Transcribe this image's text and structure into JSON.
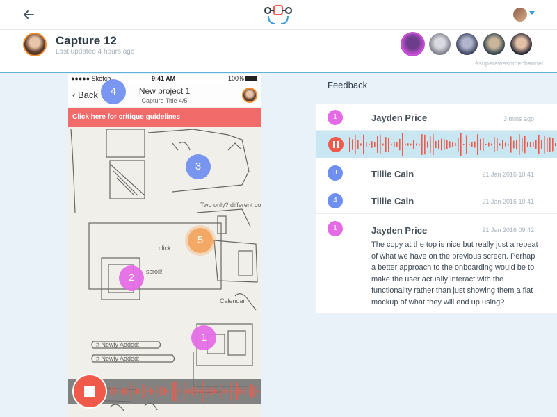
{
  "topbar": {
    "back_icon": "back-arrow-icon",
    "logo": "app-logo",
    "user_menu_icon": "chevron-down-icon"
  },
  "header": {
    "title": "Capture 12",
    "subtitle": "Last updated 4 hours ago",
    "channel": "#superawesomechannel"
  },
  "phone": {
    "status_left": "●●●●● Sketch",
    "status_time": "9:41 AM",
    "status_right": "100%",
    "back_label": "Back",
    "nav_title": "New project 1",
    "nav_subtitle": "Capture Title 4/5",
    "guidelines": "Click here for critique guidelines",
    "markers": [
      {
        "num": "4",
        "color": "blue"
      },
      {
        "num": "3",
        "color": "blue"
      },
      {
        "num": "5",
        "color": "orange"
      },
      {
        "num": "2",
        "color": "pink"
      },
      {
        "num": "1",
        "color": "pink"
      }
    ],
    "sketch_notes": [
      "Two only? different coloured",
      "click",
      "scroll!",
      "Calendar",
      "# Newly Added:",
      "# Newly Added:"
    ]
  },
  "feedback": {
    "label": "Feedback",
    "items": [
      {
        "num": "1",
        "name": "Jayden Price",
        "time": "3 mins ago",
        "color": "#e56ae6"
      },
      {
        "num": "3",
        "name": "Tillie Cain",
        "time": "21 Jan 2016 10:41",
        "color": "#6e8ff0"
      },
      {
        "num": "4",
        "name": "Tillie Cain",
        "time": "21 Jan 2016 10:41",
        "color": "#6e8ff0"
      },
      {
        "num": "1",
        "name": "Jayden Price",
        "time": "21 Jan 2016 09:42",
        "color": "#e56ae6",
        "body": "The copy at the top is nice but really just a repeat of what we have on the previous screen. Perhap a better approach to the onboarding would be to make the user actually interact with the functionality rather than just showing them a flat mockup of what they will end up using?"
      }
    ]
  },
  "colors": {
    "accent": "#5fb3d8",
    "record": "#f05a4a",
    "guidelines": "#f26b6b",
    "marker_blue": "#6e8ff0",
    "marker_pink": "#e56ae6",
    "marker_orange": "#f4a45a"
  }
}
